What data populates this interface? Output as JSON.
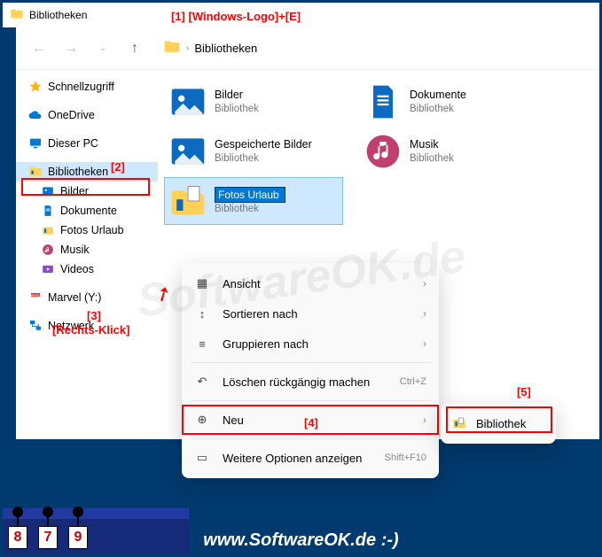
{
  "annotations": {
    "a1": "[1]  [Windows-Logo]+[E]",
    "a2": "[2]",
    "a3_num": "[3]",
    "a3_txt": "[Rechts-Klick]",
    "a4": "[4]",
    "a5": "[5]"
  },
  "titlebar": {
    "label": "Bibliotheken"
  },
  "address": {
    "crumb": "Bibliotheken"
  },
  "sidebar": {
    "quick": "Schnellzugriff",
    "onedrive": "OneDrive",
    "thispc": "Dieser PC",
    "libraries": "Bibliotheken",
    "lib_children": [
      "Bilder",
      "Dokumente",
      "Fotos Urlaub",
      "Musik",
      "Videos"
    ],
    "marvel": "Marvel (Y:)",
    "network": "Netzwerk"
  },
  "content": {
    "items": [
      {
        "name": "Bilder",
        "sub": "Bibliothek"
      },
      {
        "name": "Dokumente",
        "sub": "Bibliothek"
      },
      {
        "name": "Gespeicherte Bilder",
        "sub": "Bibliothek"
      },
      {
        "name": "Musik",
        "sub": "Bibliothek"
      }
    ],
    "editing": {
      "value": "Fotos Urlaub",
      "sub": "Bibliothek"
    }
  },
  "context_menu": {
    "view": "Ansicht",
    "sort": "Sortieren nach",
    "group": "Gruppieren nach",
    "undo": "Löschen rückgängig machen",
    "undo_key": "Ctrl+Z",
    "new": "Neu",
    "more": "Weitere Optionen anzeigen",
    "more_key": "Shift+F10"
  },
  "submenu": {
    "library": "Bibliothek"
  },
  "judges": [
    "8",
    "7",
    "9"
  ],
  "footer_url": "www.SoftwareOK.de :-)",
  "watermark": "SoftwareOK.de"
}
